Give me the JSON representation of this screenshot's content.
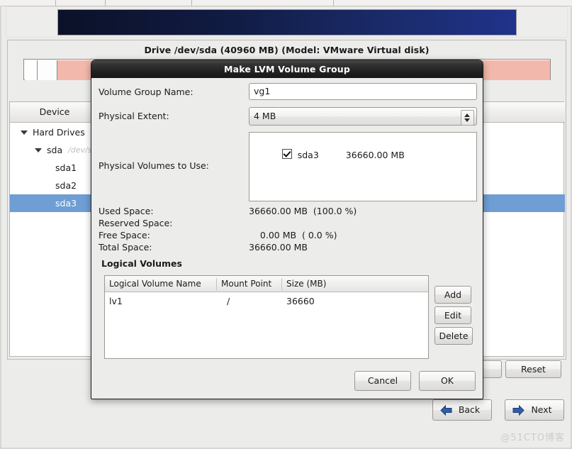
{
  "window": {
    "banner_alt": "installer-banner"
  },
  "background": {
    "drive_title": "Drive /dev/sda (40960 MB) (Model: VMware Virtual disk)",
    "device_column_header": "Device",
    "tree": [
      {
        "label": "Hard Drives",
        "sub": "",
        "depth": 0,
        "expander": true,
        "selected": false
      },
      {
        "label": "sda",
        "sub": "/dev/sda",
        "depth": 1,
        "expander": true,
        "selected": false
      },
      {
        "label": "sda1",
        "sub": "",
        "depth": 2,
        "expander": false,
        "selected": false
      },
      {
        "label": "sda2",
        "sub": "",
        "depth": 2,
        "expander": false,
        "selected": false
      },
      {
        "label": "sda3",
        "sub": "",
        "depth": 2,
        "expander": false,
        "selected": true
      }
    ],
    "reset_label": "Reset",
    "back_label": "Back",
    "next_label": "Next"
  },
  "dialog": {
    "title": "Make LVM Volume Group",
    "fields": {
      "vg_name_label": "Volume Group Name:",
      "vg_name_value": "vg1",
      "physical_extent_label": "Physical Extent:",
      "physical_extent_value": "4 MB",
      "physical_volumes_label": "Physical Volumes to Use:"
    },
    "physical_volumes": [
      {
        "name": "sda3",
        "size": "36660.00 MB",
        "checked": true
      }
    ],
    "space": [
      {
        "label": "Used Space:",
        "value": "36660.00 MB  (100.0 %)"
      },
      {
        "label": "Reserved Space:",
        "value": ""
      },
      {
        "label": "Free Space:",
        "value": "    0.00 MB  ( 0.0 %)"
      },
      {
        "label": "Total Space:",
        "value": "36660.00 MB"
      }
    ],
    "logical_volumes": {
      "section_title": "Logical Volumes",
      "columns": [
        "Logical Volume Name",
        "Mount Point",
        "Size (MB)"
      ],
      "rows": [
        {
          "name": "lv1",
          "mount_point": "/",
          "size": "36660"
        }
      ],
      "add_label": "Add",
      "edit_label": "Edit",
      "delete_label": "Delete"
    },
    "cancel_label": "Cancel",
    "ok_label": "OK"
  },
  "watermark": "@51CTO博客",
  "colors": {
    "selection_blue": "#6e9ed3",
    "banner_dark": "#0b1128",
    "banner_light": "#20328a",
    "partition_salmon": "#f2b8ab",
    "titlebar_dark": "#232323"
  }
}
